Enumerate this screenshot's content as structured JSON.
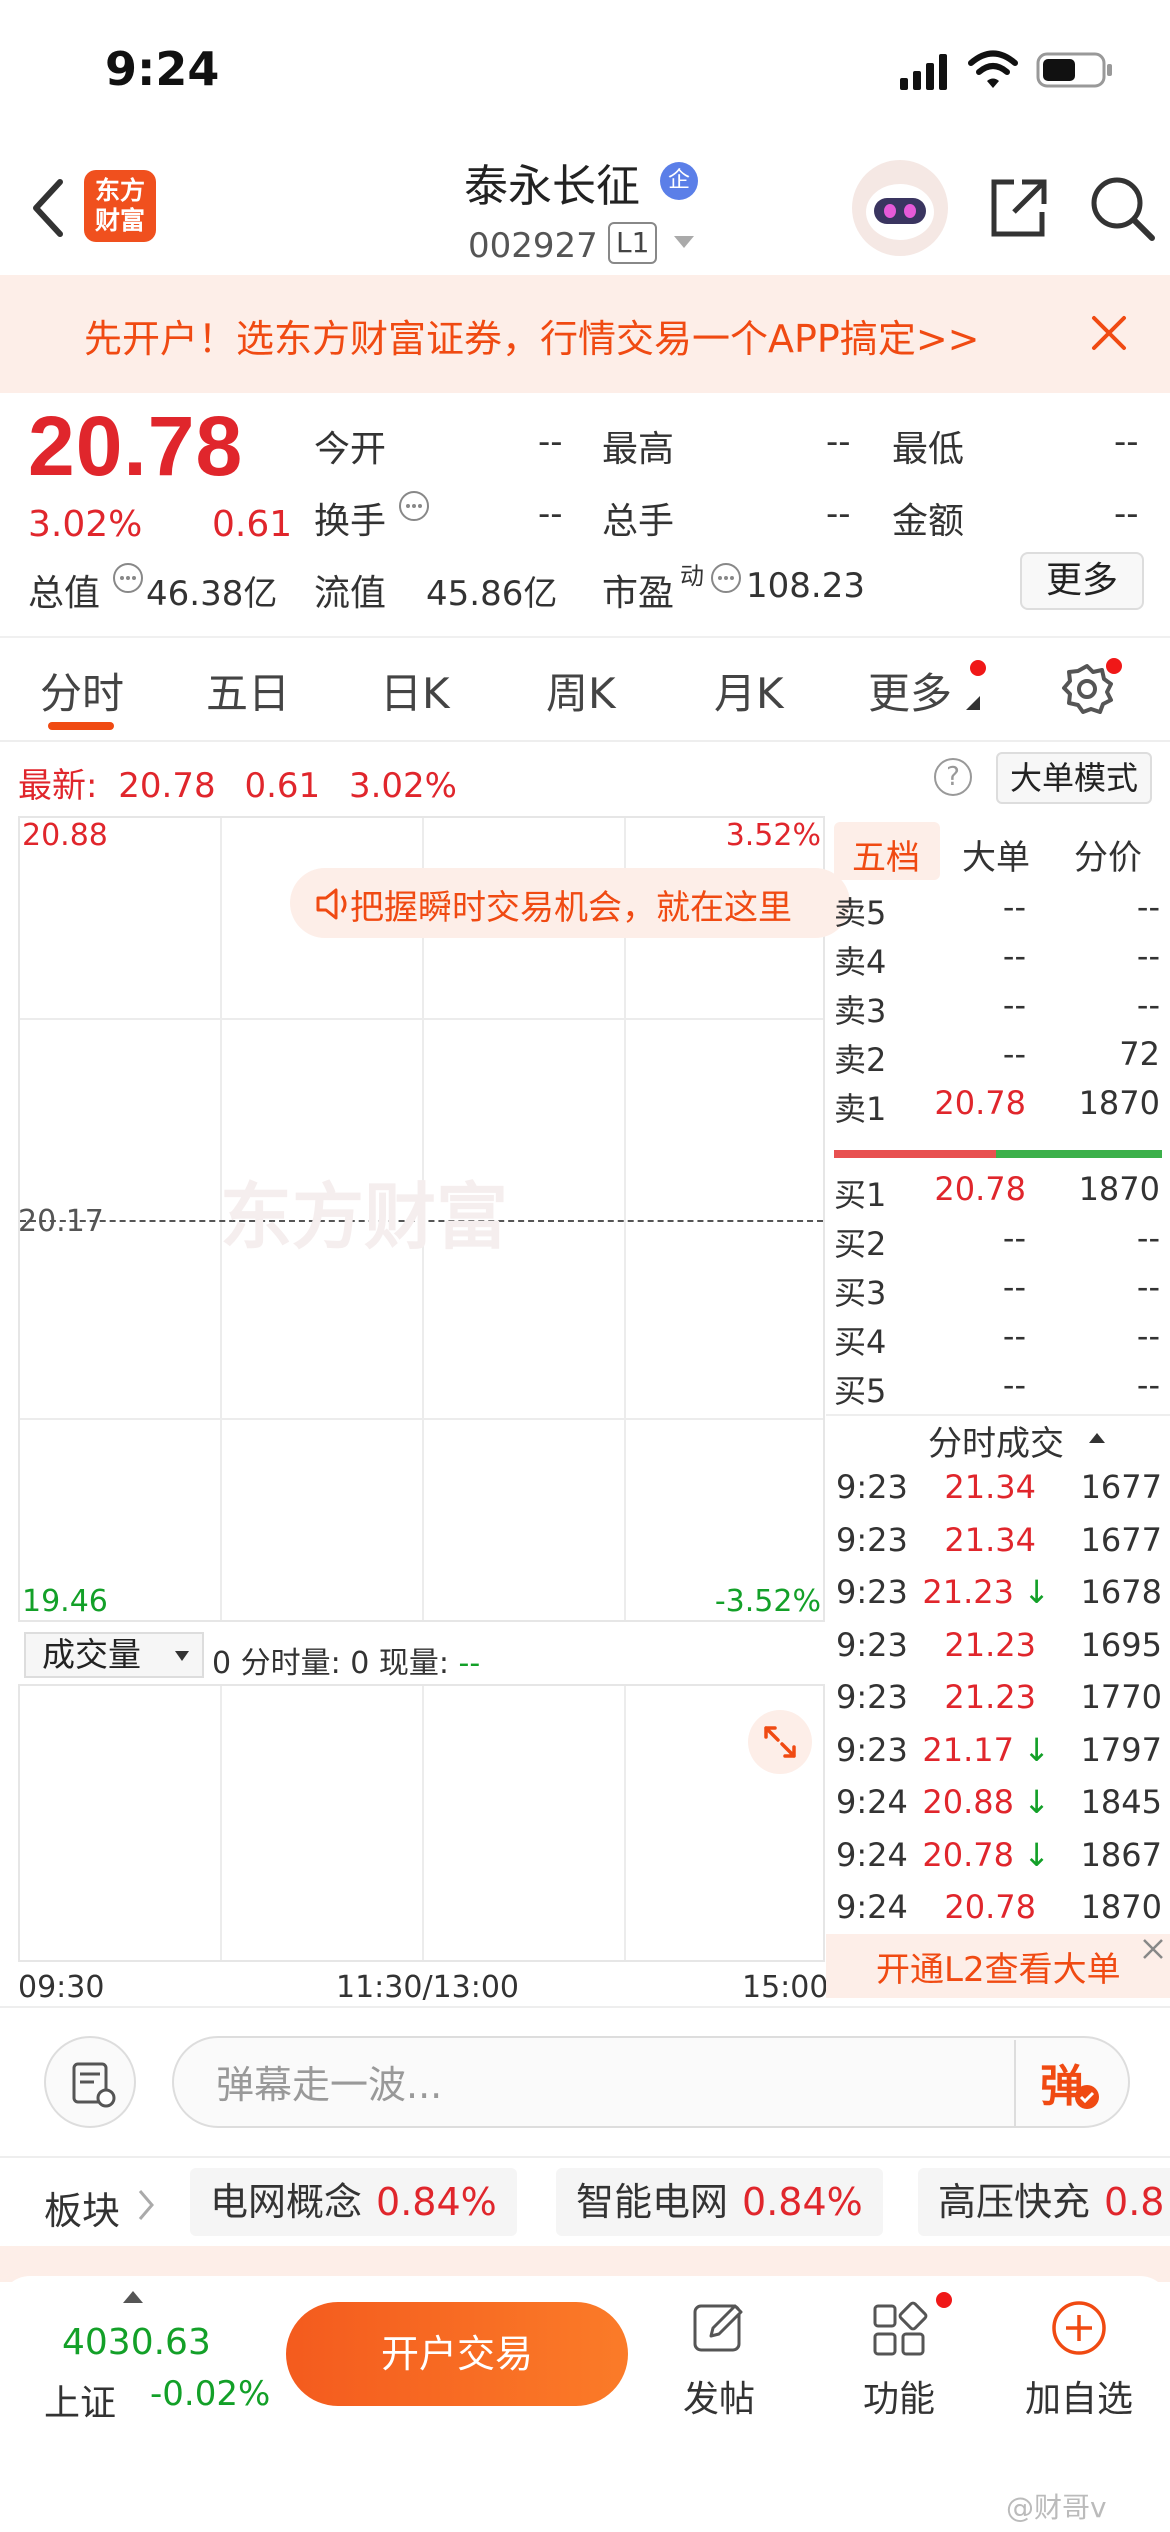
{
  "status_bar": {
    "time": "9:24"
  },
  "header": {
    "logo_line1": "东方",
    "logo_line2": "财富",
    "stock_name": "泰永长征",
    "badge": "企",
    "stock_code": "002927",
    "level": "L1"
  },
  "banner": {
    "text": "先开户！选东方财富证券，行情交易一个APP搞定>>"
  },
  "quote": {
    "price": "20.78",
    "change_pct": "3.02%",
    "change": "0.61",
    "open_label": "今开",
    "open_value": "--",
    "high_label": "最高",
    "high_value": "--",
    "low_label": "最低",
    "low_value": "--",
    "turnover_label": "换手",
    "turnover_value": "--",
    "total_vol_label": "总手",
    "total_vol_value": "--",
    "amount_label": "金额",
    "amount_value": "--",
    "mktcap_label": "总值",
    "mktcap_value": "46.38亿",
    "float_label": "流值",
    "float_value": "45.86亿",
    "pe_label": "市盈",
    "pe_sup": "动",
    "pe_value": "108.23",
    "more_button": "更多"
  },
  "tabs": [
    "分时",
    "五日",
    "日K",
    "周K",
    "月K",
    "更多"
  ],
  "chart_header": {
    "latest_label": "最新:",
    "latest_price": "20.78",
    "latest_change": "0.61",
    "latest_pct": "3.02%",
    "help": "?",
    "big_order_mode": "大单模式"
  },
  "intraday_chart": {
    "y_top": "20.88",
    "y_mid": "20.17",
    "y_bottom": "19.46",
    "pct_top": "3.52%",
    "pct_bottom": "-3.52%",
    "watermark": "东方财富",
    "notice": "把握瞬时交易机会，就在这里"
  },
  "volume": {
    "selector": "成交量",
    "stats_prefix": "0 分时量: 0 现量: ",
    "stats_now": "--",
    "time_start": "09:30",
    "time_mid": "11:30/13:00",
    "time_end": "15:00"
  },
  "order_book": {
    "tabs": [
      "五档",
      "大单",
      "分价"
    ],
    "asks": [
      {
        "label": "卖5",
        "price": "--",
        "vol": "--"
      },
      {
        "label": "卖4",
        "price": "--",
        "vol": "--"
      },
      {
        "label": "卖3",
        "price": "--",
        "vol": "--"
      },
      {
        "label": "卖2",
        "price": "--",
        "vol": "72"
      },
      {
        "label": "卖1",
        "price": "20.78",
        "vol": "1870"
      }
    ],
    "bids": [
      {
        "label": "买1",
        "price": "20.78",
        "vol": "1870"
      },
      {
        "label": "买2",
        "price": "--",
        "vol": "--"
      },
      {
        "label": "买3",
        "price": "--",
        "vol": "--"
      },
      {
        "label": "买4",
        "price": "--",
        "vol": "--"
      },
      {
        "label": "买5",
        "price": "--",
        "vol": "--"
      }
    ],
    "ticks_title": "分时成交",
    "ticks": [
      {
        "time": "9:23",
        "price": "21.34",
        "arrow": "",
        "vol": "1677"
      },
      {
        "time": "9:23",
        "price": "21.34",
        "arrow": "",
        "vol": "1677"
      },
      {
        "time": "9:23",
        "price": "21.23",
        "arrow": "↓",
        "vol": "1678"
      },
      {
        "time": "9:23",
        "price": "21.23",
        "arrow": "",
        "vol": "1695"
      },
      {
        "time": "9:23",
        "price": "21.23",
        "arrow": "",
        "vol": "1770"
      },
      {
        "time": "9:23",
        "price": "21.17",
        "arrow": "↓",
        "vol": "1797"
      },
      {
        "time": "9:24",
        "price": "20.88",
        "arrow": "↓",
        "vol": "1845"
      },
      {
        "time": "9:24",
        "price": "20.78",
        "arrow": "↓",
        "vol": "1867"
      },
      {
        "time": "9:24",
        "price": "20.78",
        "arrow": "",
        "vol": "1870"
      }
    ],
    "l2_promo": "开通L2查看大单"
  },
  "danmaku": {
    "placeholder": "弹幕走一波...",
    "send": "弹"
  },
  "sectors": {
    "label": "板块",
    "items": [
      {
        "name": "电网概念",
        "pct": "0.84%"
      },
      {
        "name": "智能电网",
        "pct": "0.84%"
      },
      {
        "name": "高压快充",
        "pct": "0.8"
      }
    ]
  },
  "bottom_nav": {
    "index_value": "4030.63",
    "index_name": "上证",
    "index_pct": "-0.02%",
    "open_trade": "开户交易",
    "post": "发帖",
    "functions": "功能",
    "add_watch": "加自选"
  },
  "watermark_credit": "@财哥v",
  "colors": {
    "up": "#e0262c",
    "down": "#13a028",
    "accent": "#f04a12"
  }
}
